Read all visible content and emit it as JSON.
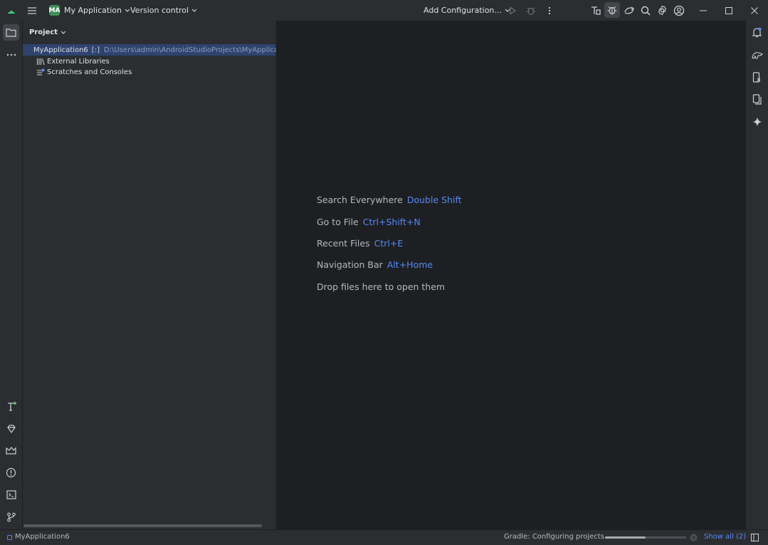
{
  "titlebar": {
    "project_badge": "MA",
    "project_name": "My Application",
    "version_control": "Version control",
    "run_config": "Add Configuration..."
  },
  "project_panel": {
    "title": "Project",
    "tree": [
      {
        "label": "MyApplication6",
        "marker": "[:]",
        "path": "D:\\Users\\admin\\AndroidStudioProjects\\MyApplicati",
        "selected": true
      },
      {
        "label": "External Libraries"
      },
      {
        "label": "Scratches and Consoles"
      }
    ]
  },
  "editor_hints": [
    {
      "label": "Search Everywhere",
      "shortcut": "Double Shift"
    },
    {
      "label": "Go to File",
      "shortcut": "Ctrl+Shift+N"
    },
    {
      "label": "Recent Files",
      "shortcut": "Ctrl+E"
    },
    {
      "label": "Navigation Bar",
      "shortcut": "Alt+Home"
    },
    {
      "label": "Drop files here to open them",
      "shortcut": ""
    }
  ],
  "statusbar": {
    "project": "MyApplication6",
    "task": "Gradle: Configuring projects...",
    "progress_fraction": 0.5,
    "show_all": "Show all (2)"
  },
  "colors": {
    "accent": "#548af7",
    "editor_bg": "#1e1f22",
    "panel_bg": "#2b2d30",
    "selection": "#2e436e",
    "project_badge": "#3d8f58"
  },
  "icons": {
    "left_strip_top": [
      "folder-icon",
      "more-icon"
    ],
    "left_strip_bottom": [
      "build-icon",
      "gem-icon",
      "layout-inspector-icon",
      "problems-icon",
      "terminal-icon",
      "git-icon"
    ],
    "right_strip": [
      "notifications-icon",
      "gradle-icon",
      "device-manager-icon",
      "running-devices-icon",
      "gemini-icon"
    ],
    "titlebar_right": [
      "build-variants-icon",
      "debug-bug-icon",
      "sync-icon",
      "search-icon",
      "settings-icon",
      "account-icon",
      "minimize-icon",
      "maximize-icon",
      "close-icon"
    ]
  }
}
